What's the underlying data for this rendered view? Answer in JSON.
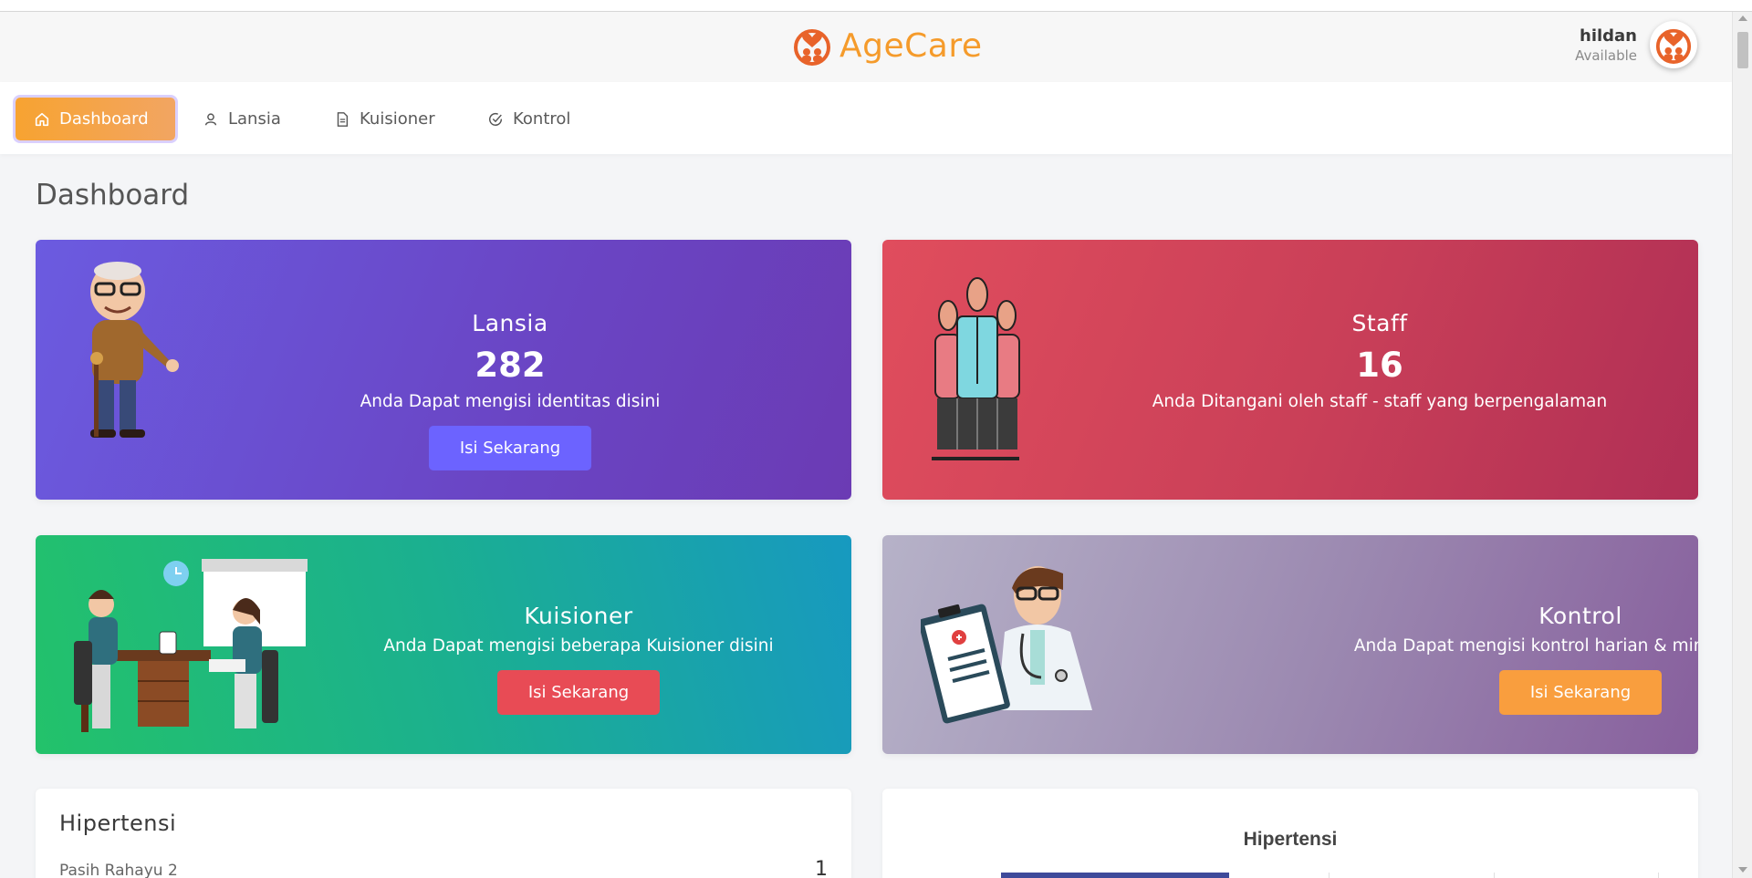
{
  "header": {
    "brand": "AgeCare",
    "user_name": "hildan",
    "user_status": "Available"
  },
  "nav": {
    "items": [
      {
        "label": "Dashboard",
        "icon": "home-icon",
        "active": true
      },
      {
        "label": "Lansia",
        "icon": "user-icon",
        "active": false
      },
      {
        "label": "Kuisioner",
        "icon": "document-icon",
        "active": false
      },
      {
        "label": "Kontrol",
        "icon": "check-circle-icon",
        "active": false
      }
    ]
  },
  "page": {
    "title": "Dashboard"
  },
  "cards": {
    "lansia": {
      "title": "Lansia",
      "value": "282",
      "desc": "Anda Dapat mengisi identitas disini",
      "button": "Isi Sekarang",
      "button_color": "#6c63ff"
    },
    "staff": {
      "title": "Staff",
      "value": "16",
      "desc": "Anda Ditangani oleh staff - staff yang berpengalaman"
    },
    "kuisioner": {
      "title": "Kuisioner",
      "desc": "Anda Dapat mengisi beberapa Kuisioner disini",
      "button": "Isi Sekarang",
      "button_color": "#e84b55"
    },
    "kontrol": {
      "title": "Kontrol",
      "desc": "Anda Dapat mengisi kontrol harian & mingguan disini",
      "button": "Isi Sekarang",
      "button_color": "#f99e3e"
    }
  },
  "panels": {
    "left": {
      "title": "Hipertensi",
      "row_label": "Pasih Rahayu 2",
      "row_value": "1"
    },
    "right": {
      "chart_title": "Hipertensi"
    }
  },
  "colors": {
    "brand": "#f59b2b",
    "nav_active": "#f7a331"
  }
}
